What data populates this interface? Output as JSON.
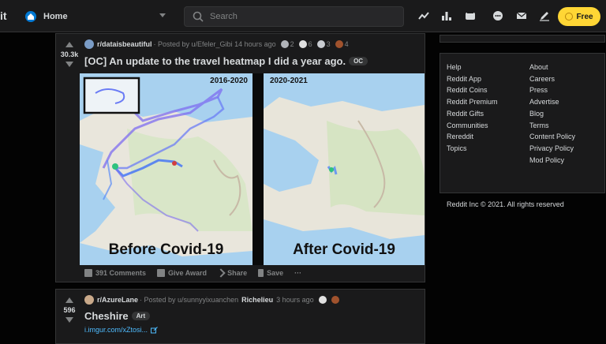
{
  "header": {
    "logo_text": "it",
    "home_label": "Home",
    "search_placeholder": "Search",
    "free_label": "Free",
    "icons": [
      "trending-icon",
      "stats-icon",
      "popular-icon",
      "chat-icon",
      "mail-icon",
      "pencil-icon"
    ]
  },
  "colors": {
    "background": "#030303",
    "card": "#1a1a1b",
    "border": "#343536",
    "text": "#d7dadc",
    "muted": "#818384",
    "accent_blue": "#0079d3",
    "free_button": "#ffd635",
    "link": "#4fbcff"
  },
  "posts": [
    {
      "score": "30.3k",
      "subreddit": "r/dataisbeautiful",
      "posted_by": "· Posted by u/Efeler_Gibi 14 hours ago",
      "awards": [
        {
          "icon": "award-icon-1",
          "count": "2"
        },
        {
          "icon": "award-icon-2",
          "count": "6"
        },
        {
          "icon": "award-icon-3",
          "count": "3"
        },
        {
          "icon": "award-icon-4",
          "count": "4"
        }
      ],
      "title": "[OC] An update to the travel heatmap I did a year ago.",
      "flair": "OC",
      "images": [
        {
          "year": "2016-2020",
          "caption": "Before Covid-19"
        },
        {
          "year": "2020-2021",
          "caption": "After Covid-19"
        }
      ],
      "actions": {
        "comments": "391 Comments",
        "give_award": "Give Award",
        "share": "Share",
        "save": "Save",
        "more": "···"
      }
    },
    {
      "score": "596",
      "subreddit": "r/AzureLane",
      "posted_by": "· Posted by u/sunnyyixuanchen",
      "user_flair": "Richelieu",
      "time": "3 hours ago",
      "title": "Cheshire",
      "flair": "Art",
      "link": "i.imgur.com/xZtosi..."
    }
  ],
  "sidebar": {
    "col1": [
      "Help",
      "Reddit App",
      "Reddit Coins",
      "Reddit Premium",
      "Reddit Gifts",
      "Communities",
      "Rereddit",
      "Topics"
    ],
    "col2": [
      "About",
      "Careers",
      "Press",
      "Advertise",
      "Blog",
      "Terms",
      "Content Policy",
      "Privacy Policy",
      "Mod Policy"
    ],
    "copyright": "Reddit Inc © 2021. All rights reserved"
  }
}
